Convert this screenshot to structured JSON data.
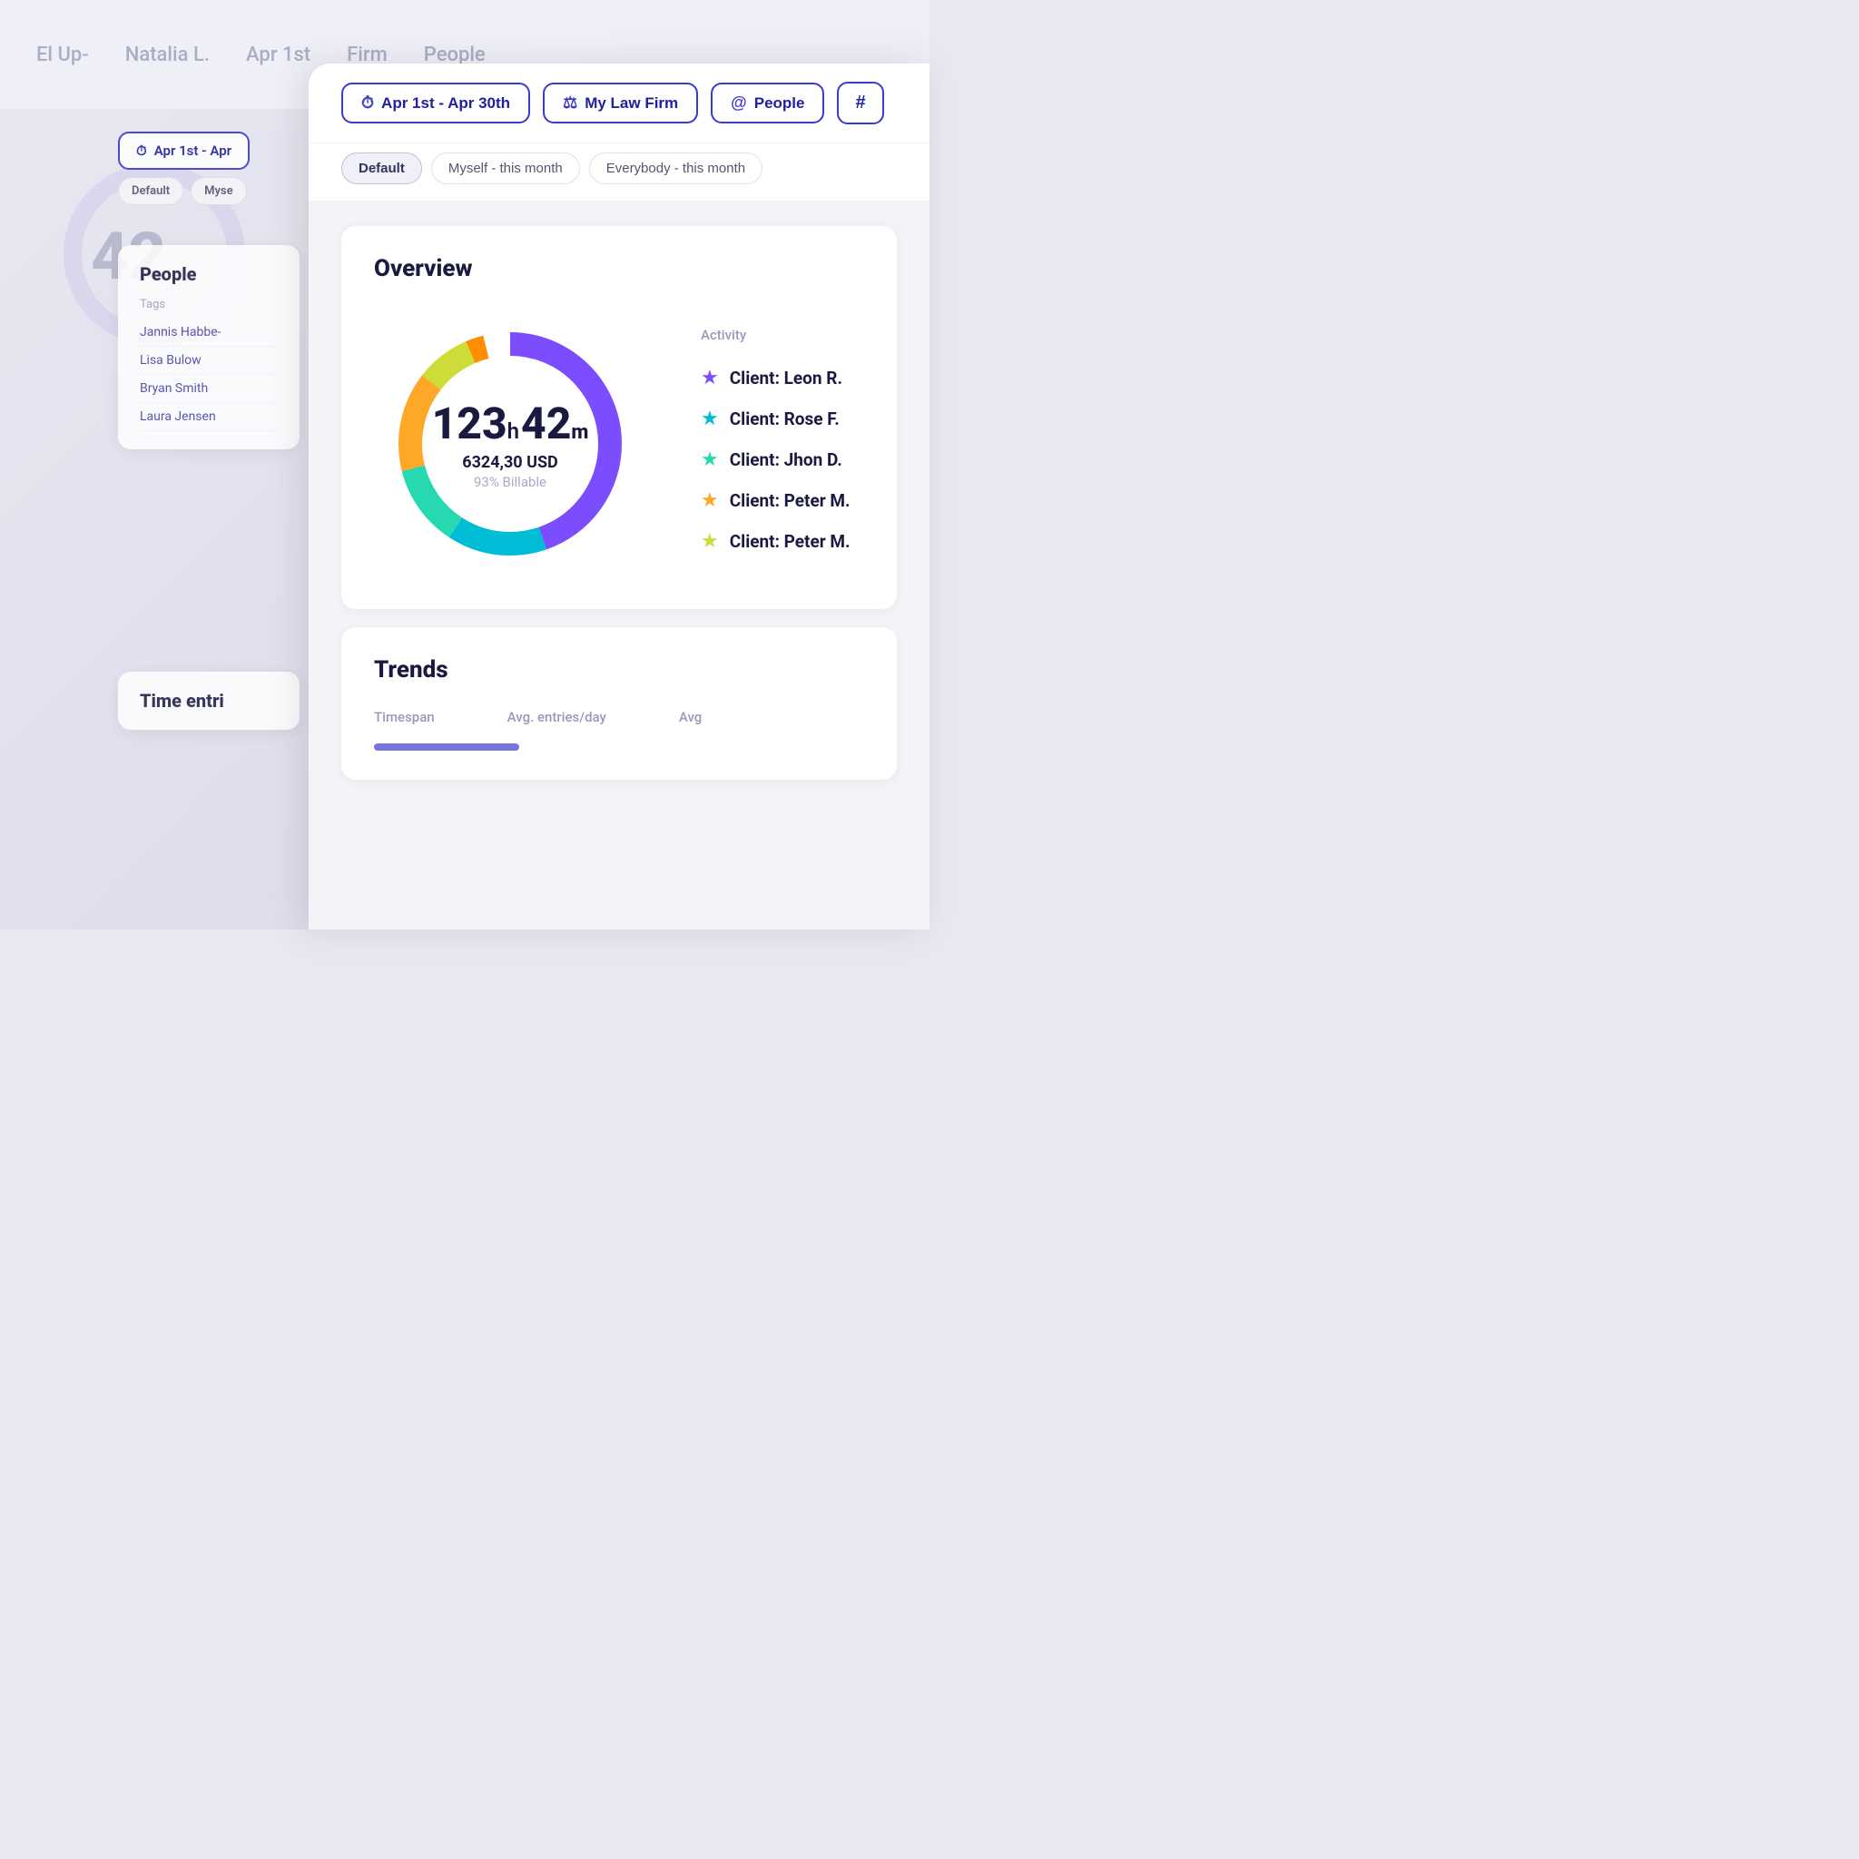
{
  "background": {
    "top_items": [
      "El Up-",
      "Natalia L.",
      "Apr 1st",
      "Firm",
      "People"
    ]
  },
  "filter_bar": {
    "date_range": "Apr 1st - Apr 30th",
    "firm": "My Law Firm",
    "people": "People",
    "hash": "#",
    "date_icon": "⏱",
    "firm_icon": "⚖",
    "people_icon": "@"
  },
  "preset_tabs": [
    {
      "label": "Default",
      "active": true
    },
    {
      "label": "Myself - this month",
      "active": false
    },
    {
      "label": "Everybody - this month",
      "active": false
    }
  ],
  "overview": {
    "title": "Overview",
    "hours": "123",
    "hours_unit": "h",
    "minutes": "42",
    "minutes_unit": "m",
    "usd": "6324,30 USD",
    "billable": "93% Billable",
    "activity_label": "Activity",
    "activity_items": [
      {
        "client": "Client: Leon R.",
        "color": "#7c4dff"
      },
      {
        "client": "Client: Rose F.",
        "color": "#00bcd4"
      },
      {
        "client": "Client: Jhon D.",
        "color": "#00897b"
      },
      {
        "client": "Client: Peter M.",
        "color": "#ffa726"
      },
      {
        "client": "Client: Peter M.",
        "color": "#cddc39"
      }
    ],
    "donut": {
      "segments": [
        {
          "color": "#7c4dff",
          "percent": 45
        },
        {
          "color": "#00bcd4",
          "percent": 15
        },
        {
          "color": "#00897b",
          "percent": 12
        },
        {
          "color": "#ffa726",
          "percent": 15
        },
        {
          "color": "#cddc39",
          "percent": 8
        },
        {
          "color": "#ff7043",
          "percent": 5
        }
      ]
    }
  },
  "trends": {
    "title": "Trends",
    "timespan_label": "Timespan",
    "avg_entries_label": "Avg. entries/day",
    "avg_label": "Avg"
  },
  "bg_people": {
    "title": "People",
    "tag_label": "Tags",
    "names": [
      "Jannis Habbe-",
      "Lisa Bulow",
      "Bryan Smith",
      "Laura Jensen"
    ]
  },
  "bg_time": {
    "title": "Time entri"
  },
  "bg_date": {
    "label": "Apr 1st - Apr",
    "presets": [
      "Default",
      "Myse"
    ]
  }
}
